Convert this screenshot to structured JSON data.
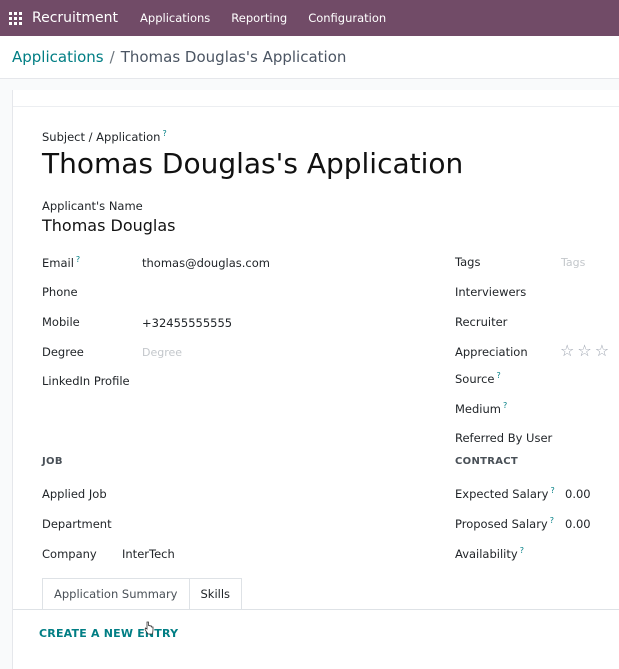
{
  "topbar": {
    "app_name": "Recruitment",
    "menu": [
      "Applications",
      "Reporting",
      "Configuration"
    ]
  },
  "breadcrumb": {
    "parent": "Applications",
    "separator": "/",
    "current": "Thomas Douglas's Application"
  },
  "form": {
    "subject_label": "Subject / Application",
    "title": "Thomas Douglas's Application",
    "applicant_name_label": "Applicant's Name",
    "applicant_name": "Thomas Douglas",
    "left_fields": {
      "email": {
        "label": "Email",
        "value": "thomas@douglas.com"
      },
      "phone": {
        "label": "Phone",
        "value": ""
      },
      "mobile": {
        "label": "Mobile",
        "value": "+32455555555"
      },
      "degree": {
        "label": "Degree",
        "placeholder": "Degree"
      },
      "linkedin": {
        "label": "LinkedIn Profile",
        "value": ""
      }
    },
    "right_fields": {
      "tags": {
        "label": "Tags",
        "placeholder": "Tags"
      },
      "interviewers": {
        "label": "Interviewers"
      },
      "recruiter": {
        "label": "Recruiter"
      },
      "appreciation": {
        "label": "Appreciation",
        "stars": 0,
        "max_stars": 3
      },
      "source": {
        "label": "Source"
      },
      "medium": {
        "label": "Medium"
      },
      "referred_by": {
        "label": "Referred By User"
      }
    },
    "job_section": {
      "title": "JOB",
      "applied_job": {
        "label": "Applied Job",
        "value": ""
      },
      "department": {
        "label": "Department",
        "value": ""
      },
      "company": {
        "label": "Company",
        "value": "InterTech"
      }
    },
    "contract_section": {
      "title": "CONTRACT",
      "expected_salary": {
        "label": "Expected Salary",
        "value": "0.00"
      },
      "proposed_salary": {
        "label": "Proposed Salary",
        "value": "0.00"
      },
      "availability": {
        "label": "Availability",
        "value": ""
      }
    },
    "help_marker": "?"
  },
  "tabs": [
    {
      "label": "Application Summary",
      "active": false
    },
    {
      "label": "Skills",
      "active": true
    }
  ],
  "create_entry_label": "CREATE A NEW ENTRY",
  "colors": {
    "brand": "#714b67",
    "accent": "#017e84"
  }
}
